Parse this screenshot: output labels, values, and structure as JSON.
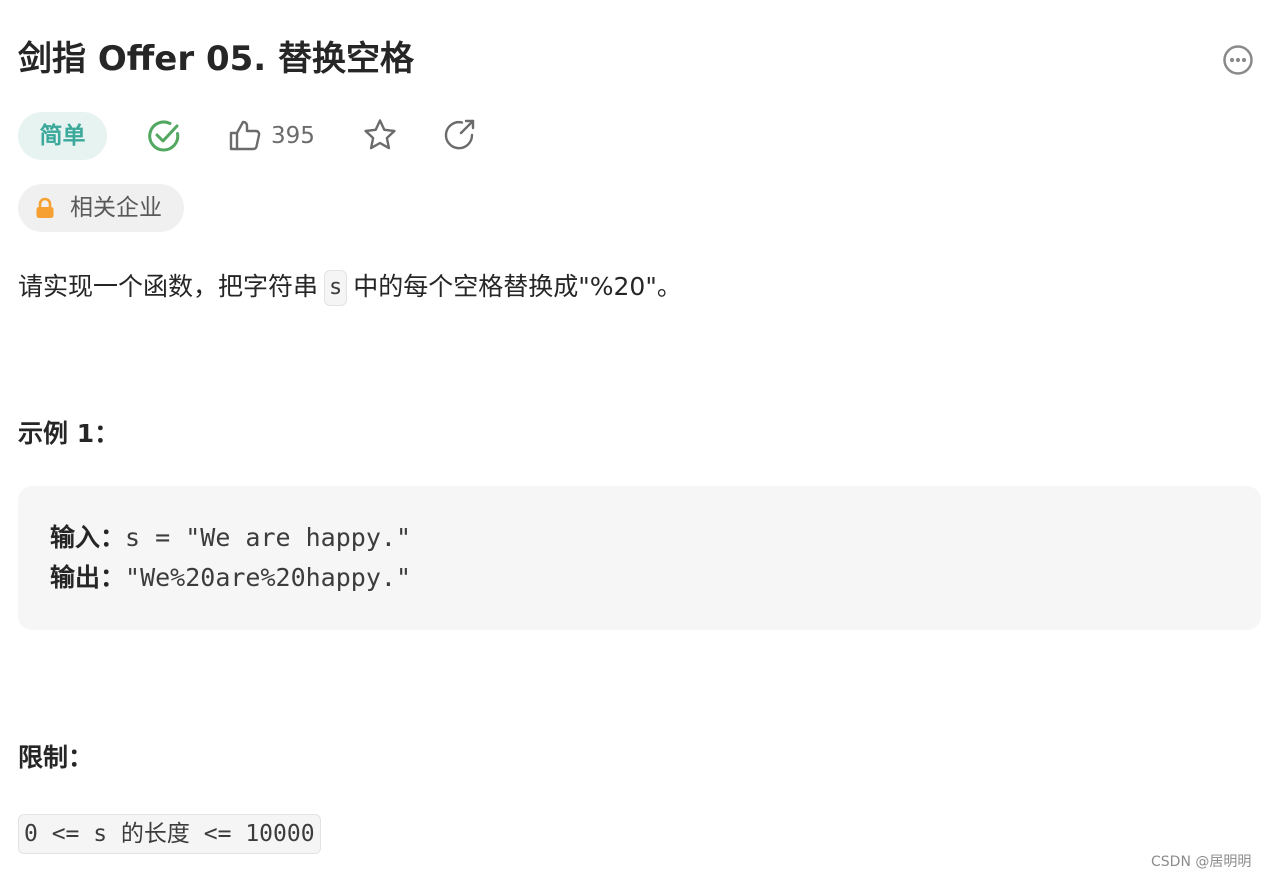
{
  "problem": {
    "title": "剑指 Offer 05. 替换空格",
    "difficulty": "简单",
    "like_count": "395",
    "company_tag": "相关企业"
  },
  "description": {
    "before_code": "请实现一个函数，把字符串",
    "code": "s",
    "after_code": "中的每个空格替换成\"%20\"。"
  },
  "example": {
    "heading": "示例 1：",
    "input_label": "输入：",
    "input_value": "s = \"We are happy.\"",
    "output_label": "输出：",
    "output_value": "\"We%20are%20happy.\""
  },
  "limits": {
    "heading": "限制：",
    "constraint": "0 <= s 的长度 <= 10000"
  },
  "watermark": "CSDN @居明明",
  "colors": {
    "difficulty_text": "#3aa89a",
    "difficulty_bg": "#e7f3f1",
    "solved_check": "#52a860",
    "lock": "#f5a030"
  },
  "icons": {
    "more": "more-icon",
    "solved": "check-circle-icon",
    "like": "thumbs-up-icon",
    "star": "star-icon",
    "share": "share-icon",
    "lock": "lock-icon"
  }
}
